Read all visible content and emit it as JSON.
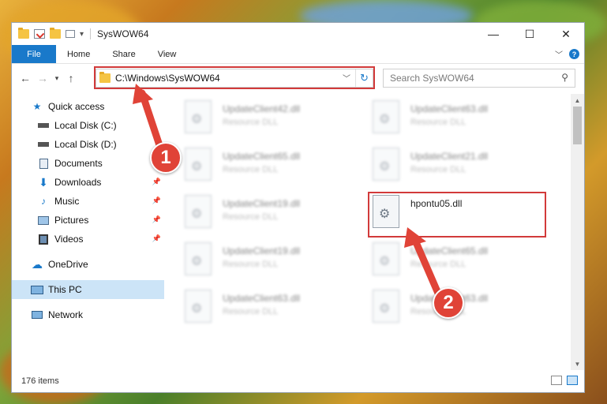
{
  "window": {
    "title": "SysWOW64",
    "controls": {
      "minimize": "—",
      "maximize": "☐",
      "close": "✕"
    }
  },
  "ribbon": {
    "tabs": [
      "File",
      "Home",
      "Share",
      "View"
    ],
    "expand_icon": "chevron-down-icon",
    "help_label": "?"
  },
  "navigation": {
    "back_icon": "arrow-left-icon",
    "forward_icon": "arrow-right-icon",
    "up_icon": "arrow-up-icon",
    "address_path": "C:\\Windows\\SysWOW64",
    "search_placeholder": "Search SysWOW64"
  },
  "sidebar": {
    "items": [
      {
        "label": "Quick access",
        "icon": "star-icon",
        "pinned": false
      },
      {
        "label": "Local Disk (C:)",
        "icon": "drive-icon",
        "pinned": false
      },
      {
        "label": "Local Disk (D:)",
        "icon": "drive-icon",
        "pinned": false
      },
      {
        "label": "Documents",
        "icon": "documents-icon",
        "pinned": true
      },
      {
        "label": "Downloads",
        "icon": "downloads-icon",
        "pinned": true
      },
      {
        "label": "Music",
        "icon": "music-icon",
        "pinned": true
      },
      {
        "label": "Pictures",
        "icon": "pictures-icon",
        "pinned": true
      },
      {
        "label": "Videos",
        "icon": "videos-icon",
        "pinned": true
      },
      {
        "label": "OneDrive",
        "icon": "cloud-icon",
        "pinned": false
      },
      {
        "label": "This PC",
        "icon": "computer-icon",
        "pinned": false,
        "selected": true
      },
      {
        "label": "Network",
        "icon": "network-icon",
        "pinned": false
      }
    ]
  },
  "files": [
    {
      "name": "UpdateClient42.dll",
      "type": "Resource DLL",
      "blurred": true
    },
    {
      "name": "UpdateClient63.dll",
      "type": "Resource DLL",
      "blurred": true
    },
    {
      "name": "UpdateClient65.dll",
      "type": "Resource DLL",
      "blurred": true
    },
    {
      "name": "UpdateClient21.dll",
      "type": "Resource DLL",
      "blurred": true
    },
    {
      "name": "UpdateClient19.dll",
      "type": "Resource DLL",
      "blurred": true
    },
    {
      "name": "hpontu05.dll",
      "type": "",
      "blurred": false,
      "highlighted": true
    },
    {
      "name": "UpdateClient19.dll",
      "type": "Resource DLL",
      "blurred": true
    },
    {
      "name": "UpdateClient65.dll",
      "type": "Resource DLL",
      "blurred": true
    },
    {
      "name": "UpdateClient63.dll",
      "type": "Resource DLL",
      "blurred": true
    },
    {
      "name": "UpdateClient63.dll",
      "type": "Resource DLL",
      "blurred": true
    }
  ],
  "status": {
    "item_count": "176 items"
  },
  "callouts": {
    "step1": "1",
    "step2": "2"
  },
  "colors": {
    "accent": "#1979ca",
    "highlight": "#d23a3a",
    "callout": "#e04337"
  }
}
